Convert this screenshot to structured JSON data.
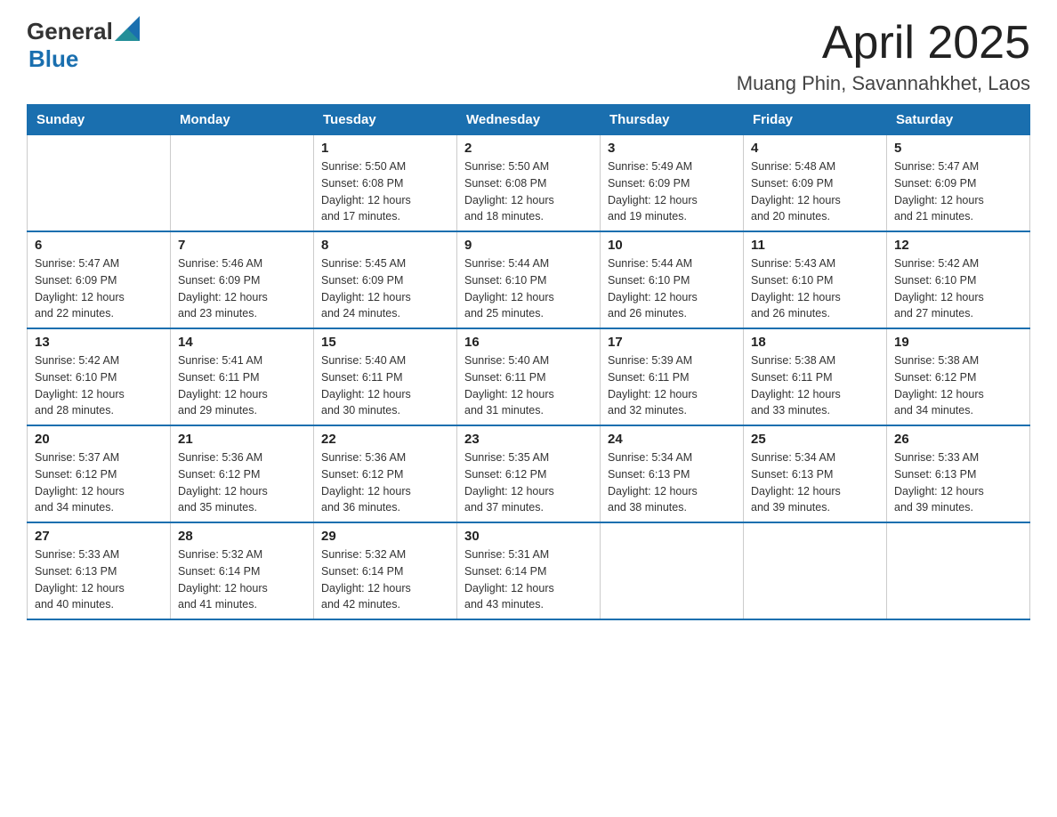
{
  "header": {
    "title": "April 2025",
    "subtitle": "Muang Phin, Savannahkhet, Laos",
    "logo_general": "General",
    "logo_blue": "Blue"
  },
  "days_of_week": [
    "Sunday",
    "Monday",
    "Tuesday",
    "Wednesday",
    "Thursday",
    "Friday",
    "Saturday"
  ],
  "weeks": [
    [
      {
        "day": "",
        "info": ""
      },
      {
        "day": "",
        "info": ""
      },
      {
        "day": "1",
        "info": "Sunrise: 5:50 AM\nSunset: 6:08 PM\nDaylight: 12 hours\nand 17 minutes."
      },
      {
        "day": "2",
        "info": "Sunrise: 5:50 AM\nSunset: 6:08 PM\nDaylight: 12 hours\nand 18 minutes."
      },
      {
        "day": "3",
        "info": "Sunrise: 5:49 AM\nSunset: 6:09 PM\nDaylight: 12 hours\nand 19 minutes."
      },
      {
        "day": "4",
        "info": "Sunrise: 5:48 AM\nSunset: 6:09 PM\nDaylight: 12 hours\nand 20 minutes."
      },
      {
        "day": "5",
        "info": "Sunrise: 5:47 AM\nSunset: 6:09 PM\nDaylight: 12 hours\nand 21 minutes."
      }
    ],
    [
      {
        "day": "6",
        "info": "Sunrise: 5:47 AM\nSunset: 6:09 PM\nDaylight: 12 hours\nand 22 minutes."
      },
      {
        "day": "7",
        "info": "Sunrise: 5:46 AM\nSunset: 6:09 PM\nDaylight: 12 hours\nand 23 minutes."
      },
      {
        "day": "8",
        "info": "Sunrise: 5:45 AM\nSunset: 6:09 PM\nDaylight: 12 hours\nand 24 minutes."
      },
      {
        "day": "9",
        "info": "Sunrise: 5:44 AM\nSunset: 6:10 PM\nDaylight: 12 hours\nand 25 minutes."
      },
      {
        "day": "10",
        "info": "Sunrise: 5:44 AM\nSunset: 6:10 PM\nDaylight: 12 hours\nand 26 minutes."
      },
      {
        "day": "11",
        "info": "Sunrise: 5:43 AM\nSunset: 6:10 PM\nDaylight: 12 hours\nand 26 minutes."
      },
      {
        "day": "12",
        "info": "Sunrise: 5:42 AM\nSunset: 6:10 PM\nDaylight: 12 hours\nand 27 minutes."
      }
    ],
    [
      {
        "day": "13",
        "info": "Sunrise: 5:42 AM\nSunset: 6:10 PM\nDaylight: 12 hours\nand 28 minutes."
      },
      {
        "day": "14",
        "info": "Sunrise: 5:41 AM\nSunset: 6:11 PM\nDaylight: 12 hours\nand 29 minutes."
      },
      {
        "day": "15",
        "info": "Sunrise: 5:40 AM\nSunset: 6:11 PM\nDaylight: 12 hours\nand 30 minutes."
      },
      {
        "day": "16",
        "info": "Sunrise: 5:40 AM\nSunset: 6:11 PM\nDaylight: 12 hours\nand 31 minutes."
      },
      {
        "day": "17",
        "info": "Sunrise: 5:39 AM\nSunset: 6:11 PM\nDaylight: 12 hours\nand 32 minutes."
      },
      {
        "day": "18",
        "info": "Sunrise: 5:38 AM\nSunset: 6:11 PM\nDaylight: 12 hours\nand 33 minutes."
      },
      {
        "day": "19",
        "info": "Sunrise: 5:38 AM\nSunset: 6:12 PM\nDaylight: 12 hours\nand 34 minutes."
      }
    ],
    [
      {
        "day": "20",
        "info": "Sunrise: 5:37 AM\nSunset: 6:12 PM\nDaylight: 12 hours\nand 34 minutes."
      },
      {
        "day": "21",
        "info": "Sunrise: 5:36 AM\nSunset: 6:12 PM\nDaylight: 12 hours\nand 35 minutes."
      },
      {
        "day": "22",
        "info": "Sunrise: 5:36 AM\nSunset: 6:12 PM\nDaylight: 12 hours\nand 36 minutes."
      },
      {
        "day": "23",
        "info": "Sunrise: 5:35 AM\nSunset: 6:12 PM\nDaylight: 12 hours\nand 37 minutes."
      },
      {
        "day": "24",
        "info": "Sunrise: 5:34 AM\nSunset: 6:13 PM\nDaylight: 12 hours\nand 38 minutes."
      },
      {
        "day": "25",
        "info": "Sunrise: 5:34 AM\nSunset: 6:13 PM\nDaylight: 12 hours\nand 39 minutes."
      },
      {
        "day": "26",
        "info": "Sunrise: 5:33 AM\nSunset: 6:13 PM\nDaylight: 12 hours\nand 39 minutes."
      }
    ],
    [
      {
        "day": "27",
        "info": "Sunrise: 5:33 AM\nSunset: 6:13 PM\nDaylight: 12 hours\nand 40 minutes."
      },
      {
        "day": "28",
        "info": "Sunrise: 5:32 AM\nSunset: 6:14 PM\nDaylight: 12 hours\nand 41 minutes."
      },
      {
        "day": "29",
        "info": "Sunrise: 5:32 AM\nSunset: 6:14 PM\nDaylight: 12 hours\nand 42 minutes."
      },
      {
        "day": "30",
        "info": "Sunrise: 5:31 AM\nSunset: 6:14 PM\nDaylight: 12 hours\nand 43 minutes."
      },
      {
        "day": "",
        "info": ""
      },
      {
        "day": "",
        "info": ""
      },
      {
        "day": "",
        "info": ""
      }
    ]
  ]
}
